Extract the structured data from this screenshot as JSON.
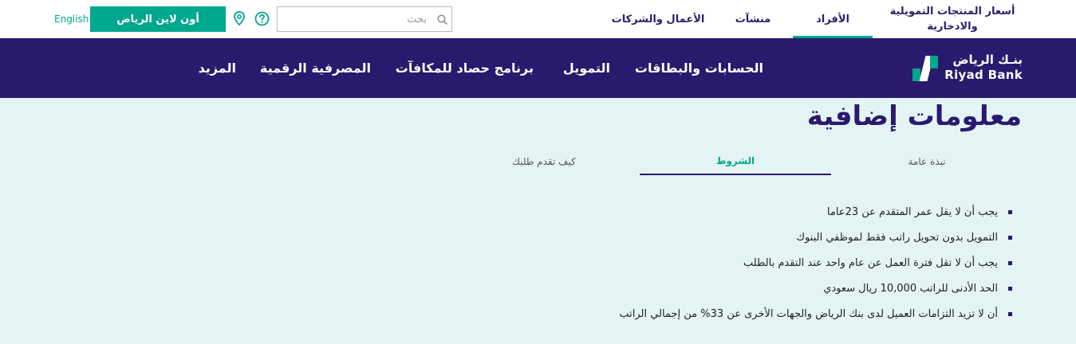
{
  "topbar": {
    "language_link": "English",
    "online_button": "أون لاين الرياض",
    "search": {
      "placeholder": "بحث"
    },
    "segments": [
      {
        "label": "الأعمال والشركات",
        "active": false
      },
      {
        "label": "منشآت",
        "active": false
      },
      {
        "label": "الأفراد",
        "active": true
      },
      {
        "label": "أسعار المنتجات التمويلية والادخارية",
        "active": false
      }
    ]
  },
  "brand": {
    "name_ar": "بنـك الرياض",
    "name_en": "Riyad Bank",
    "primary_color": "#2a1a6e",
    "accent_color": "#00a88e"
  },
  "mainnav": {
    "items": [
      {
        "label": "الحسابات والبطاقات"
      },
      {
        "label": "التمويل"
      },
      {
        "label": "برنامج حصاد للمكافآت"
      },
      {
        "label": "المصرفية الرقمية"
      },
      {
        "label": "المزيد"
      }
    ]
  },
  "content": {
    "title": "معلومات إضافية",
    "tabs": [
      {
        "label": "نبذة عامة",
        "active": false
      },
      {
        "label": "الشروط",
        "active": true
      },
      {
        "label": "كيف تقدم طلبك",
        "active": false
      }
    ],
    "conditions": [
      "يجب أن لا يقل عمر المتقدم عن 23عاما",
      "التمويل بدون تحويل راتب فقط لموظفي البنوك",
      "يجب أن لا تقل فترة العمل عن عام واحد عند التقدم بالطلب",
      "الحد الأدنى للراتب 10,000 ريال سعودي",
      "أن لا تزيد التزامات العميل لدى بنك الرياض والجهات الأخرى عن 33% من إجمالي الراتب"
    ]
  },
  "icons": {
    "location": "location-pin-icon",
    "help": "help-circle-icon",
    "search": "search-icon"
  }
}
